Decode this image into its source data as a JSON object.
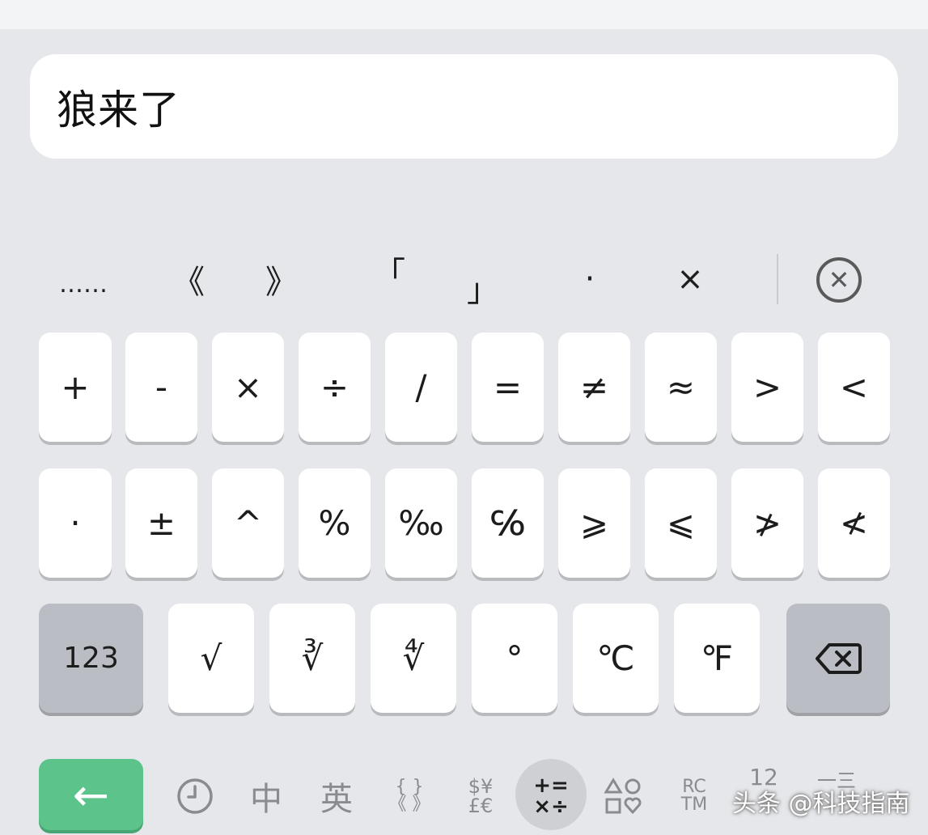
{
  "input": {
    "text": "狼来了"
  },
  "candidates": [
    "……",
    "《",
    "》",
    "「",
    "」",
    "·",
    "×"
  ],
  "row1": [
    "+",
    "-",
    "×",
    "÷",
    "/",
    "=",
    "≠",
    "≈",
    ">",
    "<"
  ],
  "row2": [
    "·",
    "±",
    "^",
    "%",
    "‰",
    "℅",
    "⩾",
    "⩽",
    "≯",
    "≮"
  ],
  "row3": {
    "mode_label": "123",
    "keys": [
      "√",
      "∛",
      "∜",
      "°",
      "℃",
      "℉"
    ]
  },
  "toolbar": {
    "enter_symbol": "←",
    "chinese_label": "中",
    "english_label": "英",
    "brackets_top": "{ }",
    "brackets_bottom": "《 》",
    "currency_top": "$¥",
    "currency_bottom": "£€",
    "math_top": "+=",
    "math_bottom": "×÷",
    "trademark_top": "RC",
    "trademark_bottom": "TM",
    "numbers_label": "12",
    "more_label": "一三"
  },
  "watermark": "头条 @科技指南",
  "colors": {
    "enter_key": "#5cc38b",
    "function_key": "#babdc3",
    "background": "#e6e7ea"
  },
  "icons": [
    "clear-candidates-icon",
    "backspace-icon",
    "clock-icon",
    "shapes-icon"
  ]
}
